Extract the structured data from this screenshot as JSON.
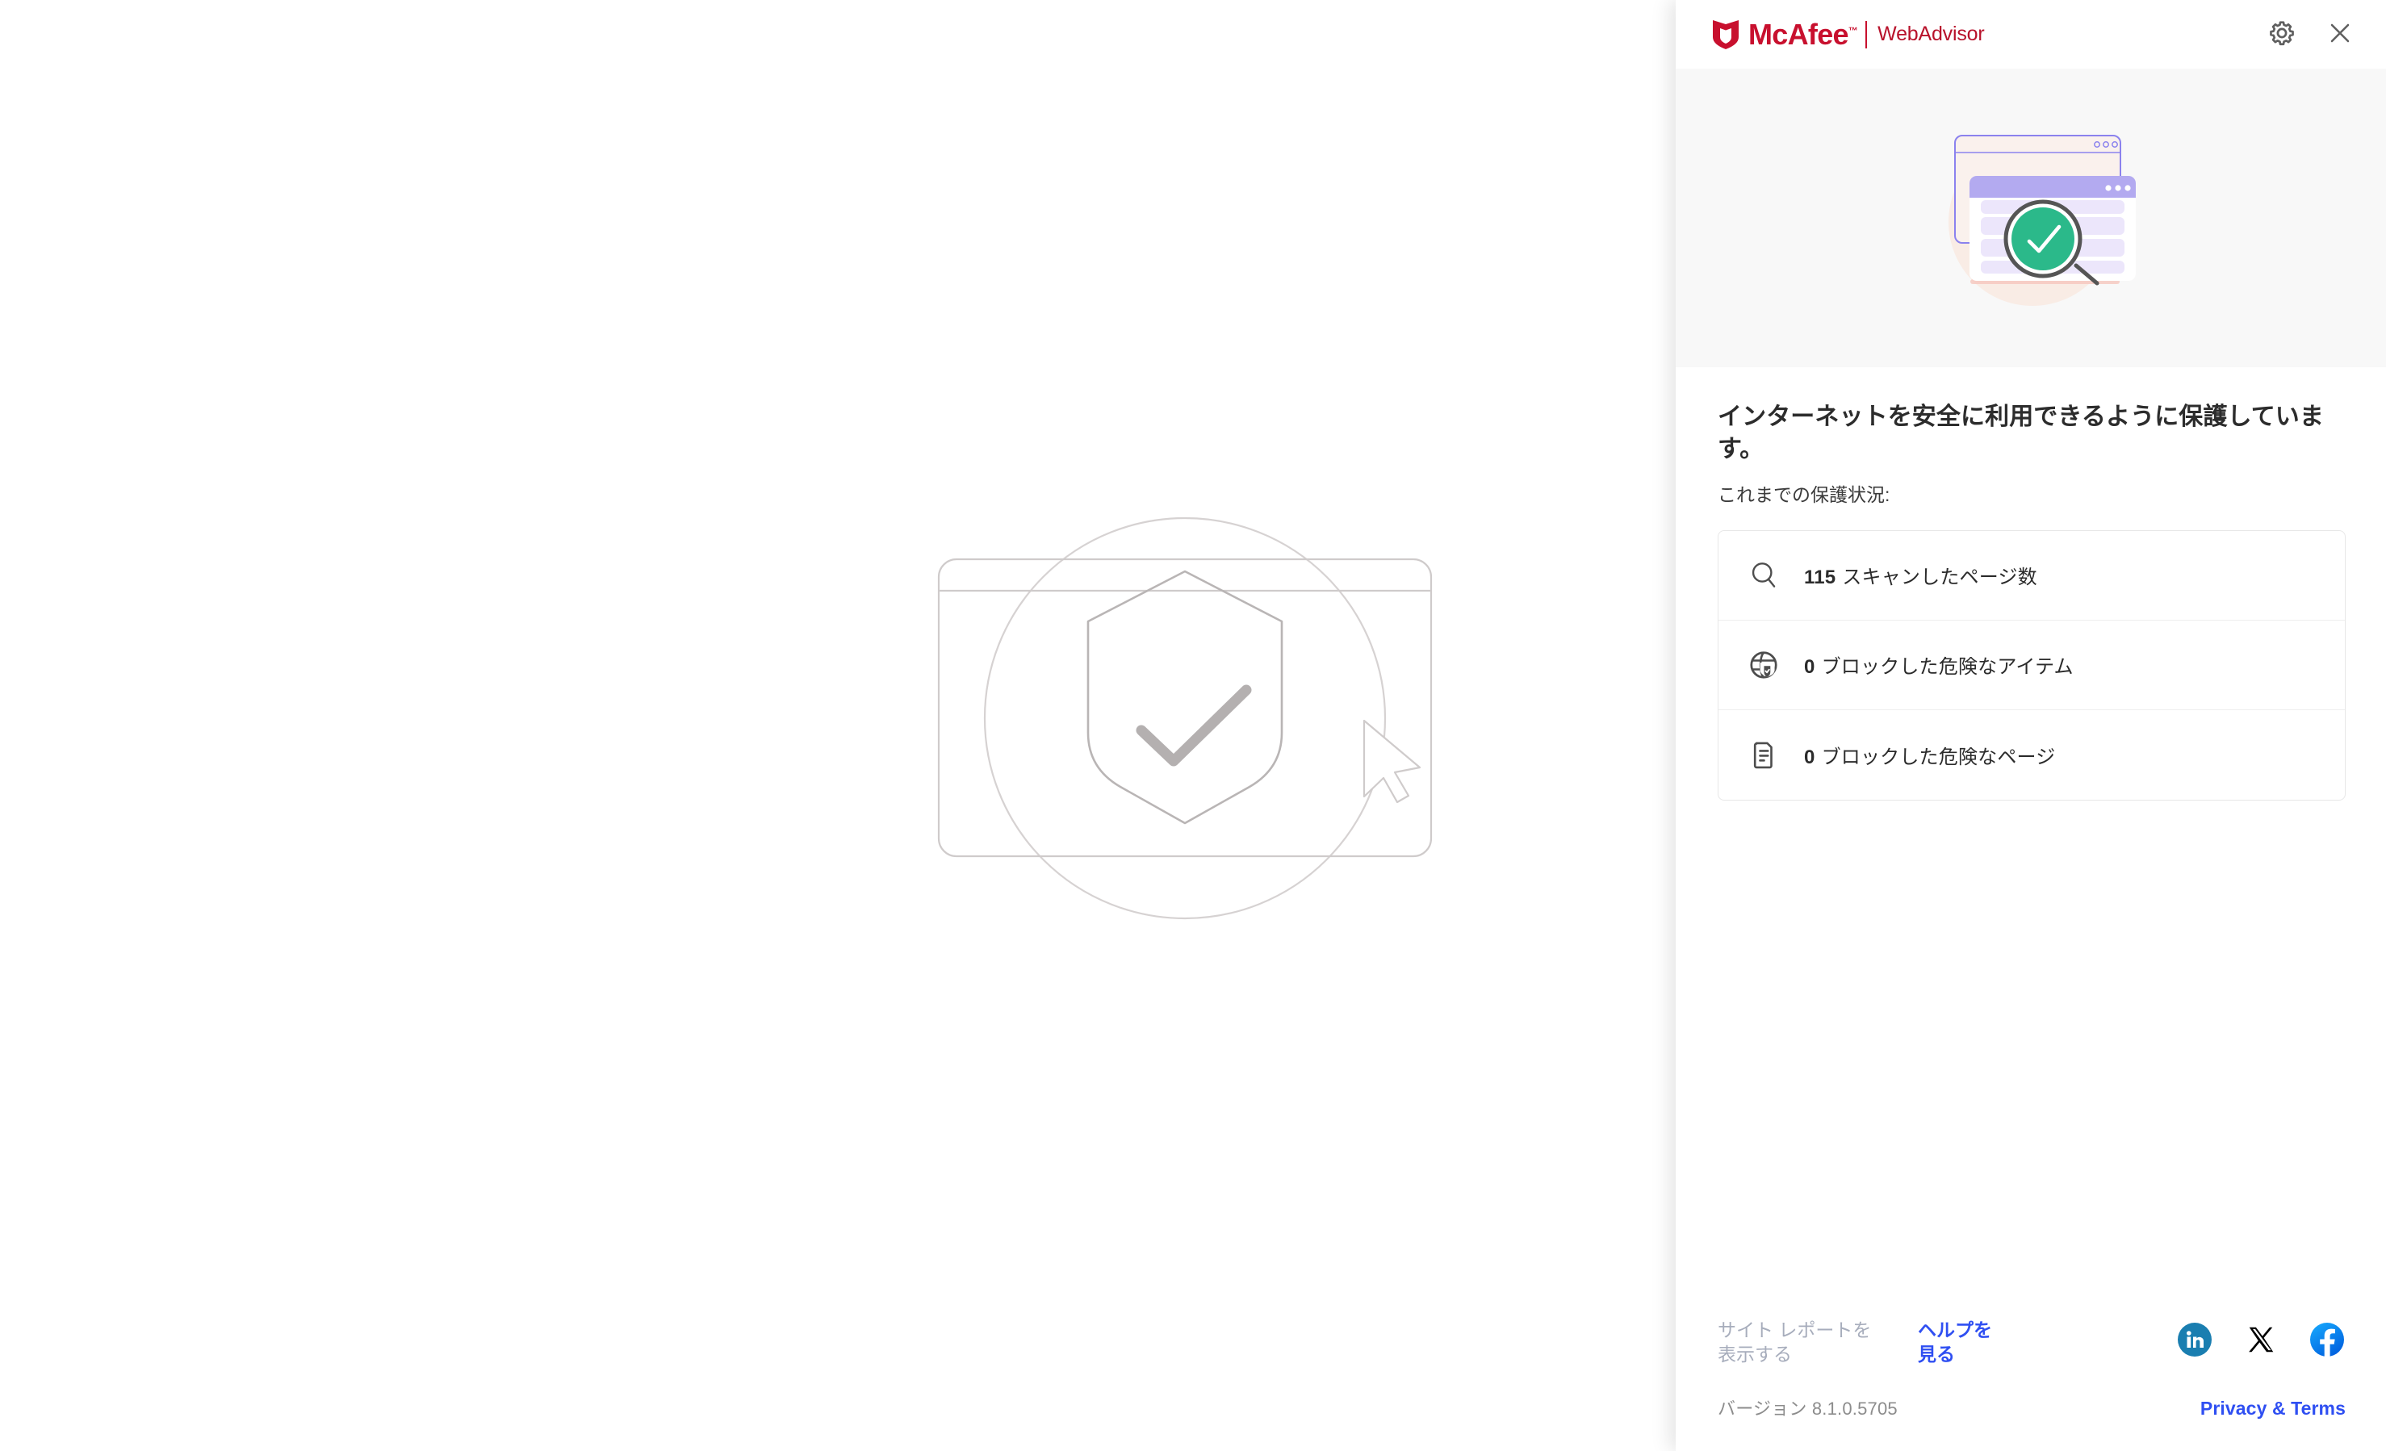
{
  "brand": {
    "name": "McAfee",
    "tm": "™",
    "product": "WebAdvisor",
    "logo_color": "#c8102e"
  },
  "header": {
    "settings_icon": "gear-icon",
    "close_icon": "close-icon"
  },
  "hero": {
    "illustration": "browser-scan-check-illustration",
    "background": "#f8f8f8",
    "accent_circle": "#f9ece5",
    "window_purple": "#8b82ee",
    "window_bar": "#b3aaf0",
    "content_row": "#ece6fb",
    "check_circle": "#2bb98a"
  },
  "main": {
    "heading": "インターネットを安全に利用できるように保護しています。",
    "subheading": "これまでの保護状況:",
    "stats": [
      {
        "icon": "search-icon",
        "value": "115",
        "label": "スキャンしたページ数"
      },
      {
        "icon": "globe-shield-icon",
        "value": "0",
        "label": "ブロックした危険なアイテム"
      },
      {
        "icon": "document-icon",
        "value": "0",
        "label": "ブロックした危険なページ"
      }
    ]
  },
  "footer": {
    "site_report_label": "サイト レポートを表示する",
    "site_report_color": "#a7adbc",
    "help_label": "ヘルプを見る",
    "link_color": "#2f4ff2",
    "social": [
      {
        "name": "linkedin-icon",
        "color": "#1a7eb0"
      },
      {
        "name": "x-twitter-icon",
        "color": "#000000"
      },
      {
        "name": "facebook-icon",
        "color": "#1b86f7"
      }
    ],
    "version_label": "バージョン 8.1.0.5705",
    "privacy_terms_label": "Privacy & Terms"
  },
  "page": {
    "illustration": "shield-check-browser-cursor-outline"
  }
}
